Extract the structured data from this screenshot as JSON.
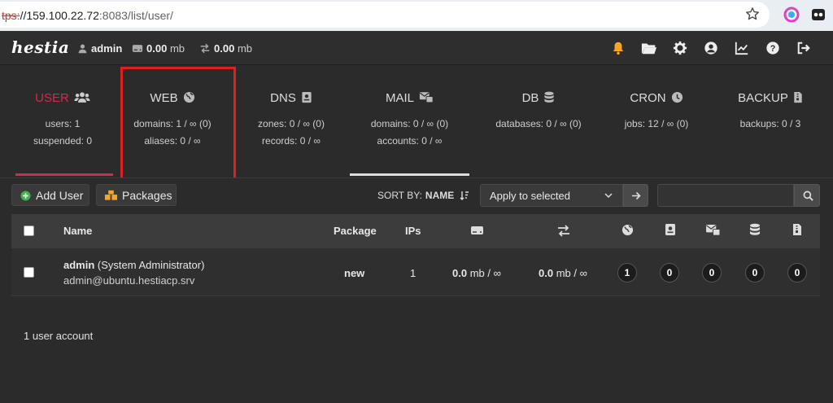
{
  "browser": {
    "url_protocol": "tps:",
    "url_host": "//159.100.22.72",
    "url_rest": ":8083/list/user/"
  },
  "header": {
    "logo": "hestia",
    "user": "admin",
    "disk": "0.00",
    "disk_unit": "mb",
    "bandwidth": "0.00",
    "bandwidth_unit": "mb"
  },
  "tabs": [
    {
      "title": "USER",
      "icon": "users-icon",
      "line1": "users: 1",
      "line2": "suspended: 0"
    },
    {
      "title": "WEB",
      "icon": "globe-icon",
      "line1": "domains: 1 / ∞ (0)",
      "line2": "aliases: 0 / ∞"
    },
    {
      "title": "DNS",
      "icon": "dns-book-icon",
      "line1": "zones: 0 / ∞ (0)",
      "line2": "records: 0 / ∞"
    },
    {
      "title": "MAIL",
      "icon": "mail-icon",
      "line1": "domains: 0 / ∞ (0)",
      "line2": "accounts: 0 / ∞"
    },
    {
      "title": "DB",
      "icon": "database-icon",
      "line1": "databases: 0 / ∞ (0)",
      "line2": ""
    },
    {
      "title": "CRON",
      "icon": "clock-icon",
      "line1": "jobs: 12 / ∞ (0)",
      "line2": ""
    },
    {
      "title": "BACKUP",
      "icon": "file-archive-icon",
      "line1": "backups: 0 / 3",
      "line2": ""
    }
  ],
  "toolbar": {
    "add_user": "Add User",
    "packages": "Packages",
    "sort_by": "SORT BY:",
    "sort_field": "NAME",
    "bulk_action": "Apply to selected",
    "search_value": ""
  },
  "table": {
    "headers": {
      "name": "Name",
      "package": "Package",
      "ips": "IPs"
    },
    "rows": [
      {
        "username": "admin",
        "fullname": "(System Administrator)",
        "email": "admin@ubuntu.hestiacp.srv",
        "package": "new",
        "ips": "1",
        "disk_value": "0.0",
        "disk_rest": "mb / ∞",
        "bw_value": "0.0",
        "bw_rest": "mb / ∞",
        "web": "1",
        "dns": "0",
        "mail": "0",
        "db": "0",
        "backups": "0"
      }
    ]
  },
  "footer": {
    "summary": "1 user account"
  },
  "colors": {
    "accent_red": "#d6294e",
    "active_underline": "#dddddd",
    "bell": "#f5a623"
  }
}
